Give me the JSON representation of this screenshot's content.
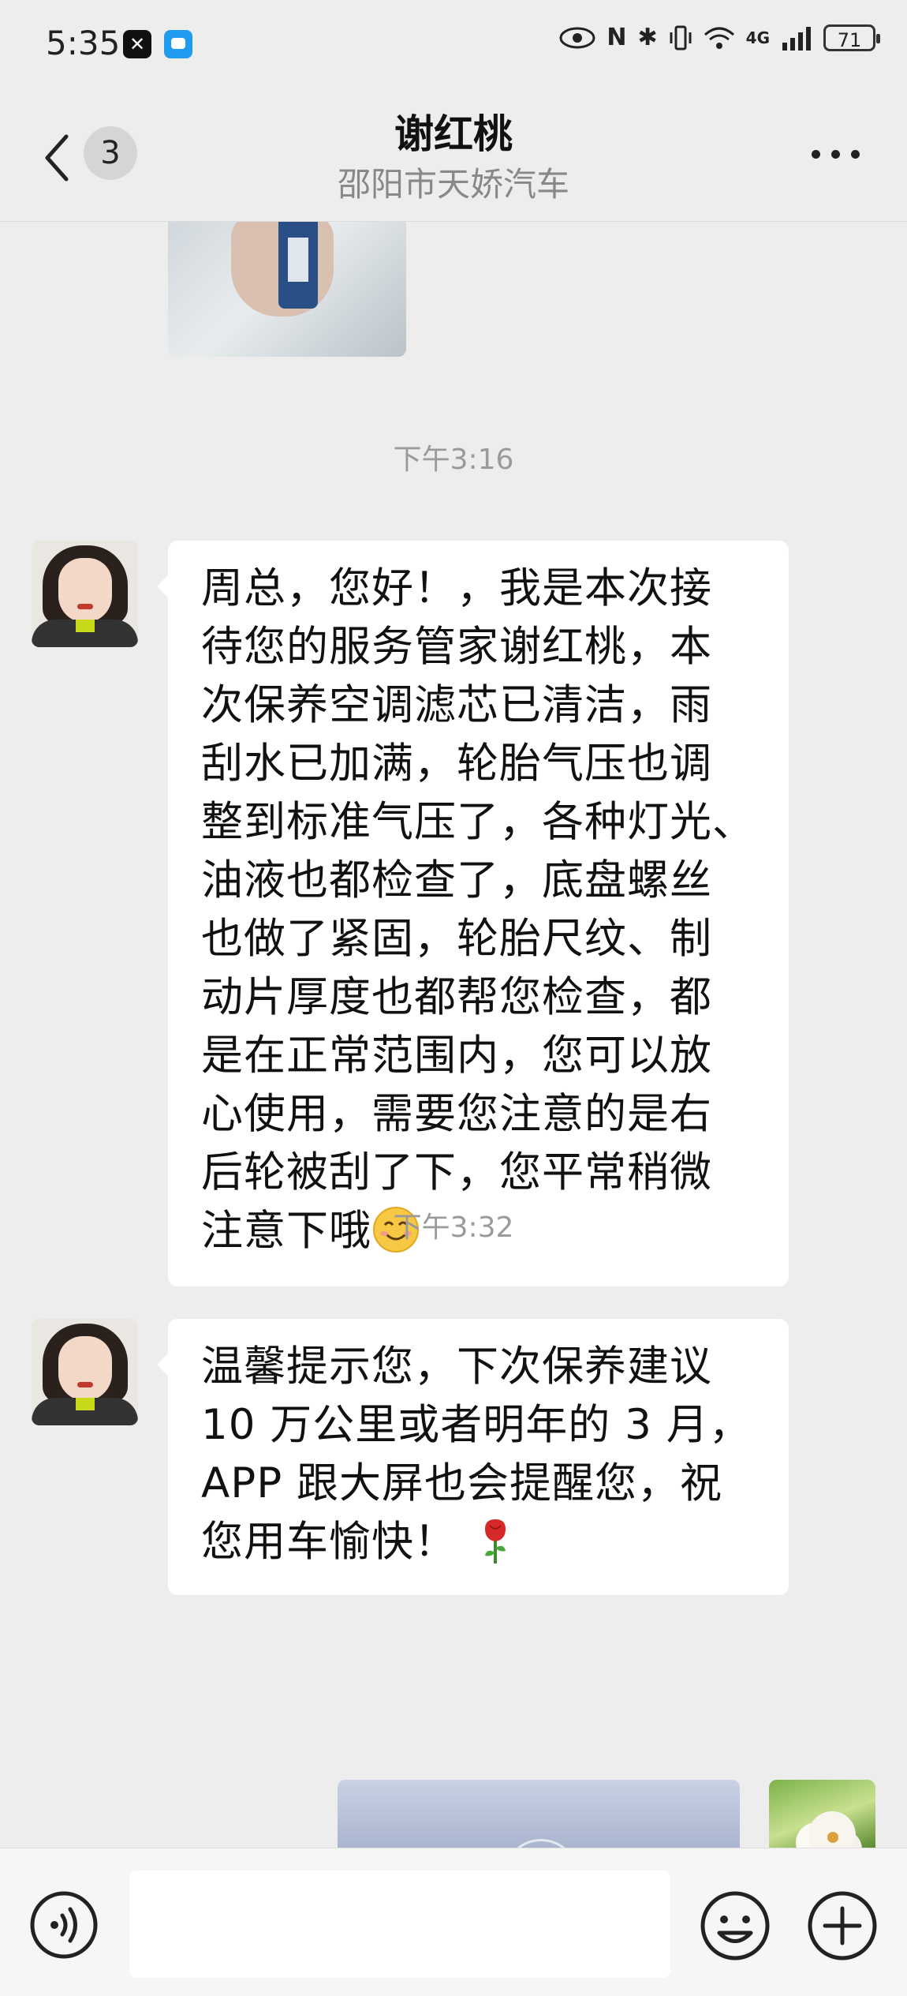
{
  "status_bar": {
    "time": "5:35",
    "network": "4G",
    "battery": "71"
  },
  "header": {
    "title": "谢红桃",
    "subtitle": "邵阳市天娇汽车",
    "unread_count": "3"
  },
  "messages": [
    {
      "type": "image",
      "sender": "contact",
      "icon": "photo-thumbnail"
    },
    {
      "type": "timestamp",
      "text": "下午3:16"
    },
    {
      "type": "text",
      "sender": "contact",
      "lines": [
        "周总，您好！，我是本次接",
        "待您的服务管家谢红桃，本",
        "次保养空调滤芯已清洁，雨",
        "刮水已加满，轮胎气压也调",
        "整到标准气压了，各种灯光、",
        "油液也都检查了，底盘螺丝",
        "也做了紧固，轮胎尺纹、制",
        "动片厚度也都帮您检查，都",
        "是在正常范围内，您可以放",
        "心使用，需要您注意的是右",
        "后轮被刮了下，您平常稍微",
        "注意下哦"
      ],
      "emoji": "smiling-face"
    },
    {
      "type": "text",
      "sender": "contact",
      "lines": [
        "温馨提示您，下次保养建议",
        "10 万公里或者明年的 3 月，",
        "APP 跟大屏也会提醒您，祝",
        "您用车愉快！"
      ],
      "emoji": "rose"
    },
    {
      "type": "timestamp",
      "text": "下午3:32"
    },
    {
      "type": "image",
      "sender": "self",
      "icon": "link-card-preview"
    }
  ],
  "input_bar": {
    "placeholder": "",
    "value": ""
  },
  "colors": {
    "background": "#ededed",
    "bubble": "#ffffff",
    "timestamp": "#9a9a9a"
  }
}
